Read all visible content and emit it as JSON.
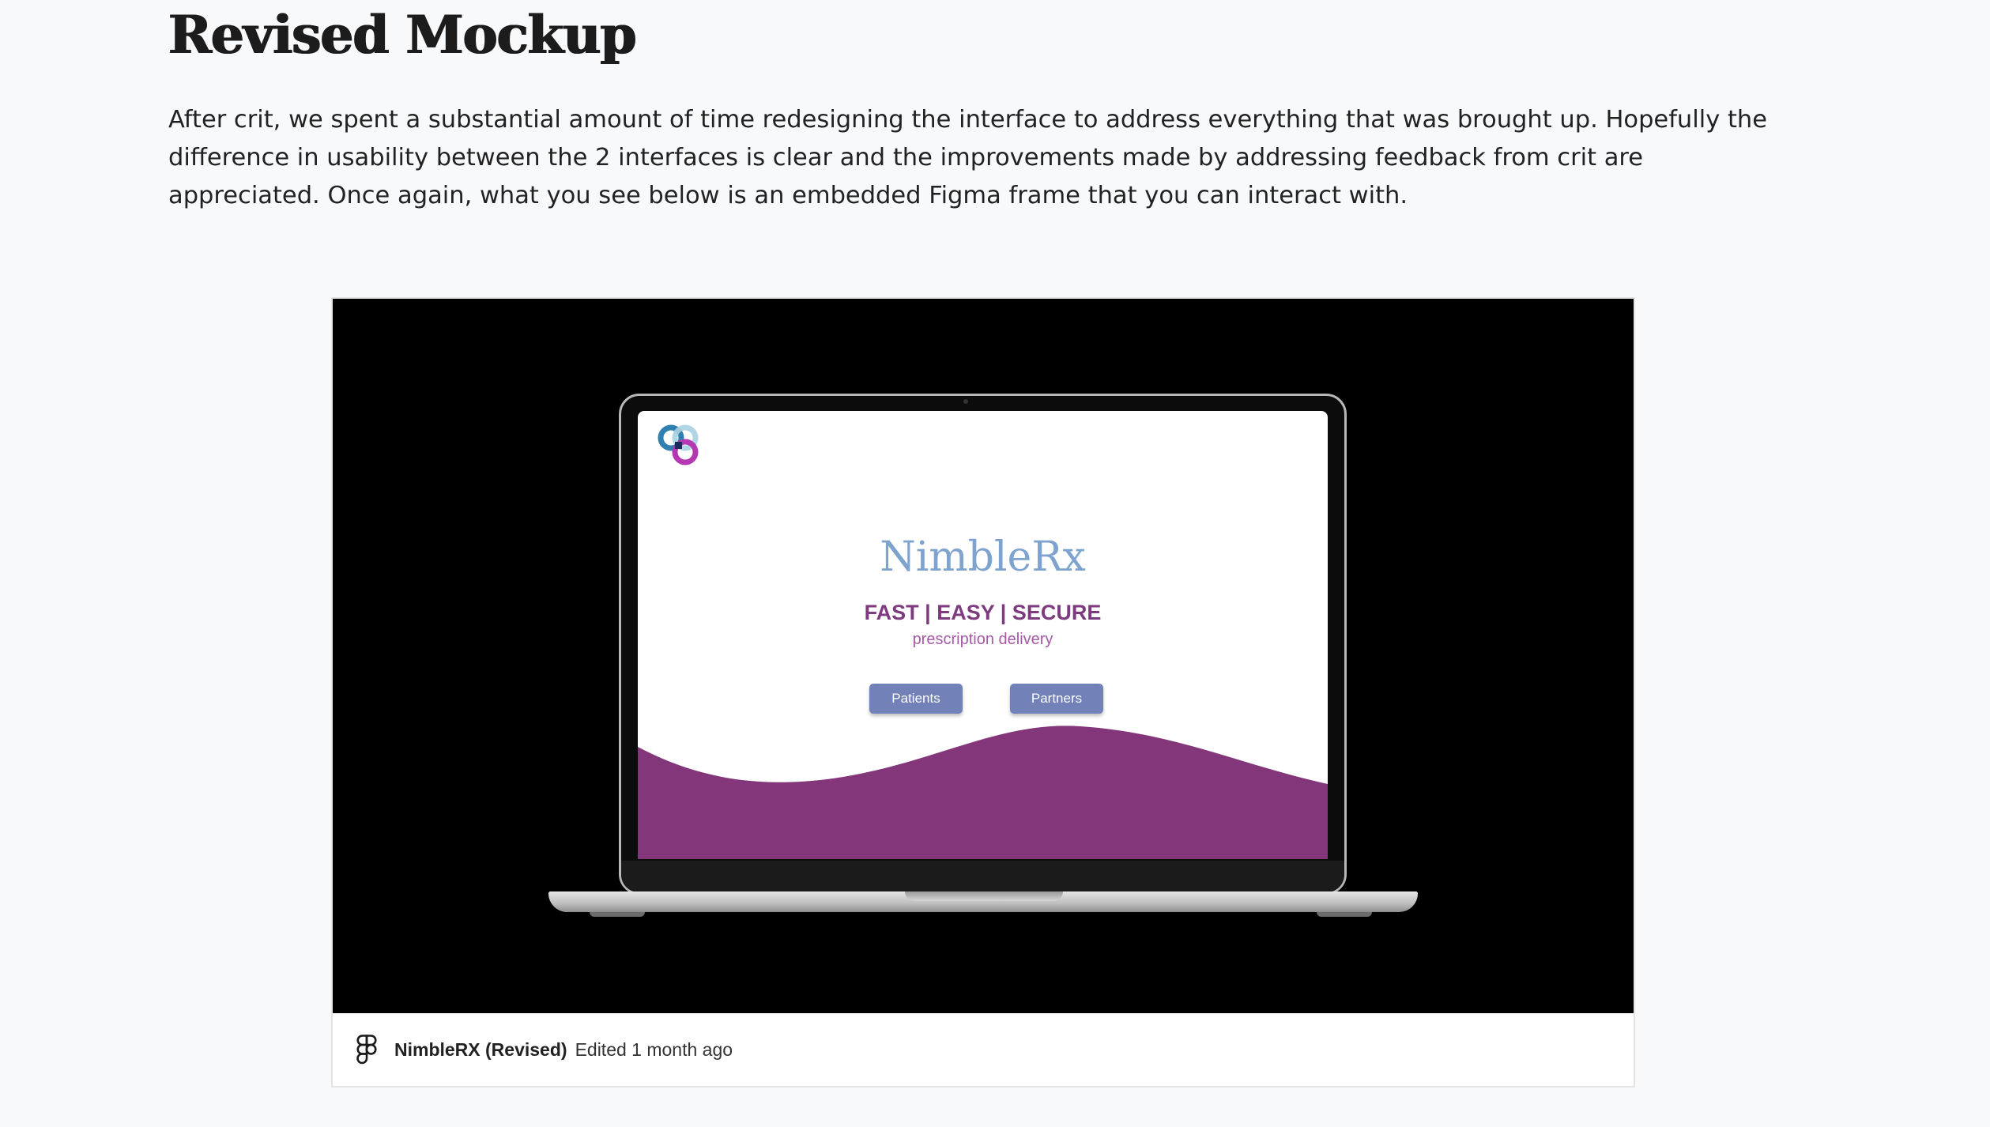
{
  "page": {
    "title": "Revised Mockup",
    "intro": "After crit, we spent a substantial amount of time redesigning the interface to address everything that was brought up. Hopefully the difference in usability between the 2 interfaces is clear and the improvements made by addressing feedback from crit are appreciated. Once again, what you see below is an embedded Figma frame that you can interact with."
  },
  "embed": {
    "file_name": "NimbleRX (Revised)",
    "edited": "Edited 1 month ago",
    "icon": "figma-icon",
    "mockup": {
      "brand": "NimbleRx",
      "tagline": "FAST | EASY | SECURE",
      "subtitle": "prescription delivery",
      "buttons": [
        "Patients",
        "Partners"
      ],
      "colors": {
        "brand_text": "#7fa3cf",
        "tagline": "#7d3a7e",
        "wave": "#833679",
        "button": "#7281b8"
      }
    }
  }
}
